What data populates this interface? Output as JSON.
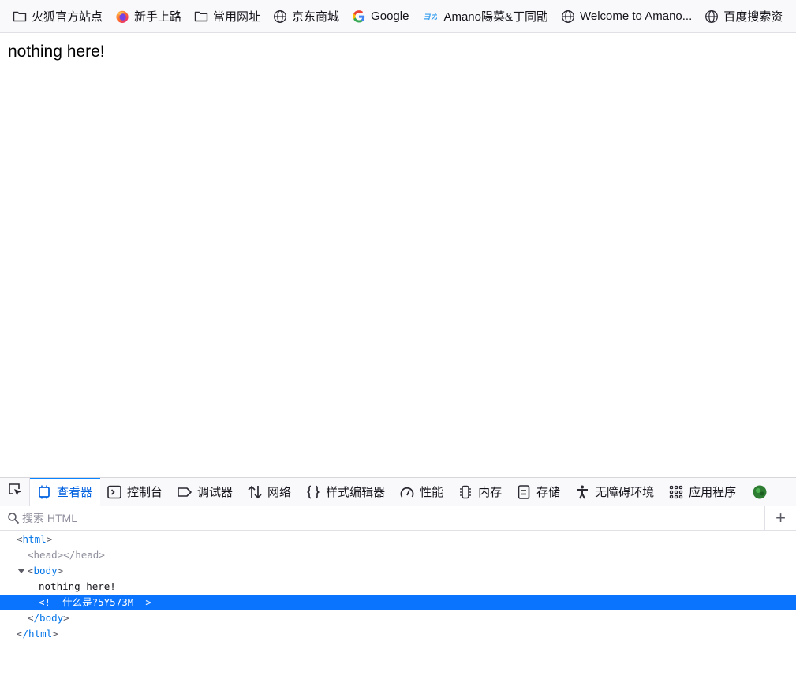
{
  "bookmarks": [
    {
      "label": "火狐官方站点",
      "icon": "folder-icon"
    },
    {
      "label": "新手上路",
      "icon": "firefox-icon"
    },
    {
      "label": "常用网址",
      "icon": "folder-icon"
    },
    {
      "label": "京东商城",
      "icon": "globe-icon"
    },
    {
      "label": "Google",
      "icon": "google-icon"
    },
    {
      "label": "Amano陽菜&丁同勖",
      "icon": "amano-logo-icon",
      "logo_text": "ヨカ"
    },
    {
      "label": "Welcome to Amano...",
      "icon": "globe-icon"
    },
    {
      "label": "百度搜索资",
      "icon": "globe-icon"
    }
  ],
  "page": {
    "text": "nothing here!"
  },
  "devtools": {
    "tabs": [
      {
        "label": "查看器",
        "icon": "inspector-icon",
        "active": true
      },
      {
        "label": "控制台",
        "icon": "console-icon"
      },
      {
        "label": "调试器",
        "icon": "debugger-icon"
      },
      {
        "label": "网络",
        "icon": "network-icon"
      },
      {
        "label": "样式编辑器",
        "icon": "style-editor-icon"
      },
      {
        "label": "性能",
        "icon": "performance-icon"
      },
      {
        "label": "内存",
        "icon": "memory-icon"
      },
      {
        "label": "存储",
        "icon": "storage-icon"
      },
      {
        "label": "无障碍环境",
        "icon": "accessibility-icon"
      },
      {
        "label": "应用程序",
        "icon": "application-icon"
      }
    ],
    "search_placeholder": "搜索 HTML",
    "add_node_symbol": "+",
    "tree": {
      "html_open": "html",
      "head_open": "head",
      "head_close": "/head",
      "body_open": "body",
      "body_text": "nothing here!",
      "comment": "<!--什么是?5Y573M-->",
      "body_close": "/body",
      "html_close": "/html"
    }
  },
  "colors": {
    "accent": "#0a84ff",
    "selection": "#0a74ff",
    "tag": "#0074e8"
  }
}
